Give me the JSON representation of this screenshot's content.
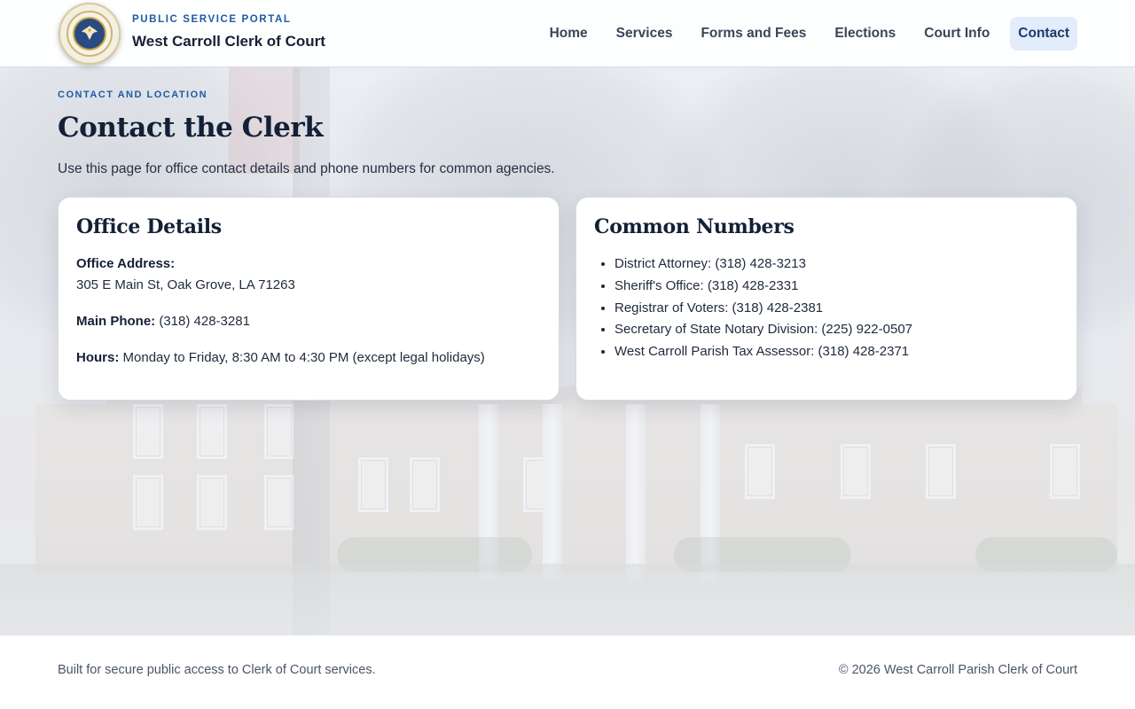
{
  "header": {
    "kicker": "PUBLIC SERVICE PORTAL",
    "title": "West Carroll Clerk of Court",
    "logo_icon": "parish-seal-icon"
  },
  "nav": {
    "items": [
      {
        "label": "Home"
      },
      {
        "label": "Services"
      },
      {
        "label": "Forms and Fees"
      },
      {
        "label": "Elections"
      },
      {
        "label": "Court Info"
      },
      {
        "label": "Contact",
        "active": true
      }
    ]
  },
  "page": {
    "kicker": "CONTACT AND LOCATION",
    "title": "Contact the Clerk",
    "lead": "Use this page for office contact details and phone numbers for common agencies."
  },
  "office": {
    "heading": "Office Details",
    "address_label": "Office Address:",
    "address": "305 E Main St, Oak Grove, LA 71263",
    "phone_label": "Main Phone:",
    "phone": "(318) 428-3281",
    "hours_label": "Hours:",
    "hours": "Monday to Friday, 8:30 AM to 4:30 PM (except legal holidays)"
  },
  "numbers": {
    "heading": "Common Numbers",
    "items": [
      "District Attorney: (318) 428-3213",
      "Sheriff's Office: (318) 428-2331",
      "Registrar of Voters: (318) 428-2381",
      "Secretary of State Notary Division: (225) 922-0507",
      "West Carroll Parish Tax Assessor: (318) 428-2371"
    ]
  },
  "footer": {
    "left": "Built for secure public access to Clerk of Court services.",
    "right": "© 2026 West Carroll Parish Clerk of Court"
  },
  "colors": {
    "accent": "#1f5aa6",
    "nav_active_bg": "#e3ecfa",
    "heading": "#132036"
  }
}
